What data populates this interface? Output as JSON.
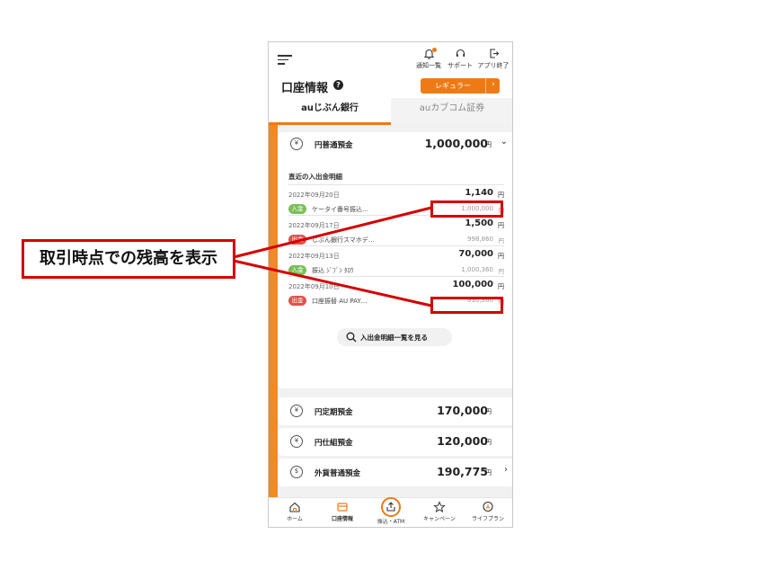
{
  "header": {
    "actions": [
      {
        "label": "通知一覧",
        "icon": "bell-icon"
      },
      {
        "label": "サポート",
        "icon": "headset-icon"
      },
      {
        "label": "アプリ終了",
        "icon": "exit-icon"
      }
    ],
    "title": "口座情報",
    "help_glyph": "?",
    "rank": "レギュラー",
    "rank_chev": "›"
  },
  "tabs": [
    {
      "label": "auじぶん銀行",
      "active": true
    },
    {
      "label": "auカブコム証券",
      "active": false
    }
  ],
  "main_account": {
    "icon_glyph": "¥",
    "name": "円普通預金",
    "amount": "1,000,000",
    "yen": "円",
    "chev": "⌄",
    "history_title": "直近の入出金明細",
    "transactions": [
      {
        "date": "2022年09月20日",
        "amount": "1,140",
        "type": "入金",
        "desc": "ケータイ番号振込…",
        "balance": "1,000,000"
      },
      {
        "date": "2022年09月17日",
        "amount": "1,500",
        "type": "出金",
        "desc": "じぶん銀行スマホデ…",
        "balance": "998,860"
      },
      {
        "date": "2022年09月13日",
        "amount": "70,000",
        "type": "入金",
        "desc": "振込 ｼﾞﾌﾞﾝ ﾀﾛｳ",
        "balance": "1,000,360"
      },
      {
        "date": "2022年09月10日",
        "amount": "100,000",
        "type": "出金",
        "desc": "口座振替 AU PAY…",
        "balance": "930,360"
      }
    ],
    "yen_mark": "円",
    "more_label": "入出金明細一覧を見る"
  },
  "accounts": [
    {
      "name": "円定期預金",
      "amount": "170,000",
      "glyph": "¥",
      "chev": ""
    },
    {
      "name": "円仕組預金",
      "amount": "120,000",
      "glyph": "¥",
      "chev": ""
    },
    {
      "name": "外貨普通預金",
      "amount": "190,775",
      "glyph": "$",
      "chev": "›"
    }
  ],
  "bottom_nav": [
    {
      "label": "ホーム",
      "icon": "home-icon"
    },
    {
      "label": "口座情報",
      "icon": "account-icon"
    },
    {
      "label": "振込・ATM",
      "icon": "transfer-icon"
    },
    {
      "label": "キャンペーン",
      "icon": "star-icon"
    },
    {
      "label": "ライフプラン",
      "icon": "lifeplan-icon"
    }
  ],
  "annotation": {
    "callout": "取引時点での残高を表示"
  },
  "colors": {
    "accent": "#ee7a16",
    "highlight": "#d40000",
    "deposit": "#7bbf5b",
    "withdrawal": "#e0514b"
  }
}
